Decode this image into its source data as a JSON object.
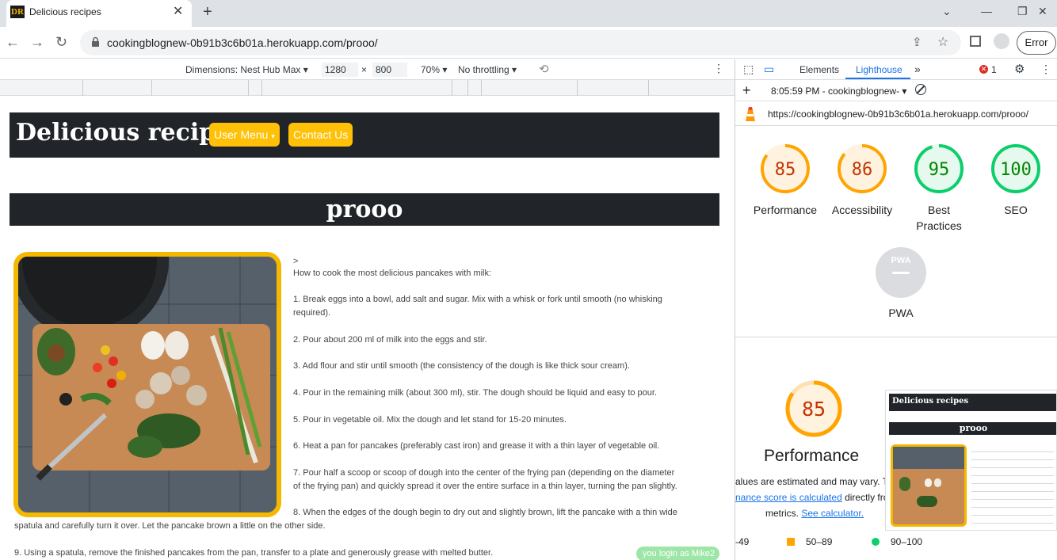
{
  "browser": {
    "tab_title": "Delicious recipes",
    "favicon_text": "DR",
    "url": "cookingblognew-0b91b3c6b01a.herokuapp.com/prooo/",
    "error_label": "Error"
  },
  "device_toolbar": {
    "dimensions_label": "Dimensions: Nest Hub Max",
    "width": "1280",
    "times": "×",
    "height": "800",
    "zoom": "70%",
    "throttling": "No throttling"
  },
  "site": {
    "brand": "Delicious recipes",
    "user_menu": "User Menu",
    "contact": "Contact Us",
    "post_title": "prooo",
    "recipe_lines": [
      ">",
      "How to cook the most delicious pancakes with milk:",
      "1. Break eggs into a bowl, add salt and sugar. Mix with a whisk or fork until smooth (no whisking",
      "required).",
      "2. Pour about 200 ml of milk into the eggs and stir.",
      "3. Add flour and stir until smooth (the consistency of the dough is like thick sour cream).",
      "4. Pour in the remaining milk (about 300 ml), stir. The dough should be liquid and easy to pour.",
      "5. Pour in vegetable oil. Mix the dough and let stand for 15-20 minutes.",
      "6. Heat a pan for pancakes (preferably cast iron) and grease it with a thin layer of vegetable oil.",
      "7. Pour half a scoop or scoop of dough into the center of the frying pan (depending on the diameter",
      "of the frying pan) and quickly spread it over the entire surface in a thin layer, turning the pan slightly.",
      "8. When the edges of the dough begin to dry out and slightly brown, lift the pancake with a thin wide",
      "spatula and carefully turn it over. Let the pancake brown a little on the other side.",
      "9. Using a spatula, remove the finished pancakes from the pan, transfer to a plate and generously grease with melted butter."
    ],
    "toast": "you login as Mike2"
  },
  "devtools": {
    "tabs": [
      "Elements",
      "Lighthouse"
    ],
    "error_count": "1",
    "report_time": "8:05:59 PM - cookingblognew-",
    "report_url": "https://cookingblognew-0b91b3c6b01a.herokuapp.com/prooo/",
    "scores": [
      {
        "label": "Performance",
        "value": "85",
        "color": "#ffa400",
        "fg": "#c33300",
        "bg": "#fff3e0"
      },
      {
        "label": "Accessibility",
        "value": "86",
        "color": "#ffa400",
        "fg": "#c33300",
        "bg": "#fff3e0"
      },
      {
        "label": "Best Practices",
        "value": "95",
        "color": "#0cce6b",
        "fg": "#008800",
        "bg": "#e6f9ee"
      },
      {
        "label": "SEO",
        "value": "100",
        "color": "#0cce6b",
        "fg": "#008800",
        "bg": "#e6f9ee"
      }
    ],
    "pwa_label": "PWA",
    "pwa_badge": "PWA",
    "detail_score": "85",
    "detail_title": "Performance",
    "estimate_prefix": "alues are estimated and may vary. Th",
    "calc_link": "nance score is calculated",
    "calc_suffix": " directly fro",
    "metrics_prefix": "metrics. ",
    "see_calc": "See calculator.",
    "legend": [
      "-49",
      "50–89",
      "90–100"
    ],
    "thumb_brand": "Delicious recipes",
    "thumb_title": "prooo"
  }
}
